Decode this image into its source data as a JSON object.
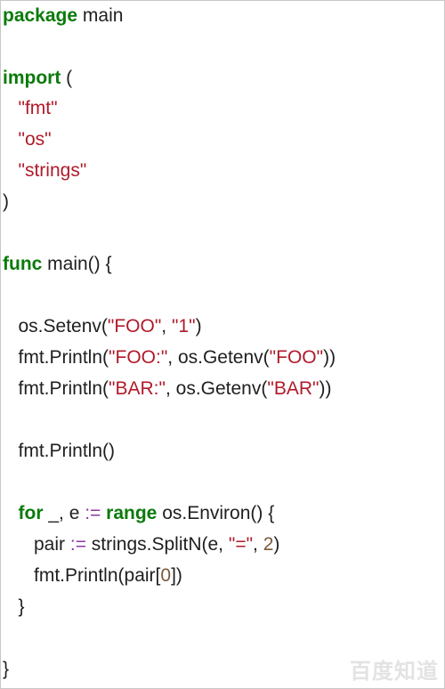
{
  "code": {
    "l1": {
      "kw": "package",
      "rest": " main"
    },
    "l3": {
      "kw": "import",
      "rest": " ("
    },
    "l4": {
      "indent": "   ",
      "str": "\"fmt\""
    },
    "l5": {
      "indent": "   ",
      "str": "\"os\""
    },
    "l6": {
      "indent": "   ",
      "str": "\"strings\""
    },
    "l7": {
      "text": ")"
    },
    "l9": {
      "kw": "func",
      "rest": " main() {"
    },
    "l11": {
      "a": "   os.Setenv(",
      "s1": "\"FOO\"",
      "b": ", ",
      "s2": "\"1\"",
      "c": ")"
    },
    "l12": {
      "a": "   fmt.Println(",
      "s1": "\"FOO:\"",
      "b": ", os.Getenv(",
      "s2": "\"FOO\"",
      "c": "))"
    },
    "l13": {
      "a": "   fmt.Println(",
      "s1": "\"BAR:\"",
      "b": ", os.Getenv(",
      "s2": "\"BAR\"",
      "c": "))"
    },
    "l15": {
      "text": "   fmt.Println()"
    },
    "l17": {
      "indent": "   ",
      "kw1": "for",
      "a": " _, e ",
      "op": ":=",
      "b": " ",
      "kw2": "range",
      "c": " os.Environ() {"
    },
    "l18": {
      "a": "      pair ",
      "op": ":=",
      "b": " strings.SplitN(e, ",
      "s": "\"=\"",
      "c": ", ",
      "n": "2",
      "d": ")"
    },
    "l19": {
      "a": "      fmt.Println(pair[",
      "n": "0",
      "b": "])"
    },
    "l20": {
      "text": "   }"
    },
    "l22": {
      "text": "}"
    }
  },
  "watermark": "百度知道"
}
